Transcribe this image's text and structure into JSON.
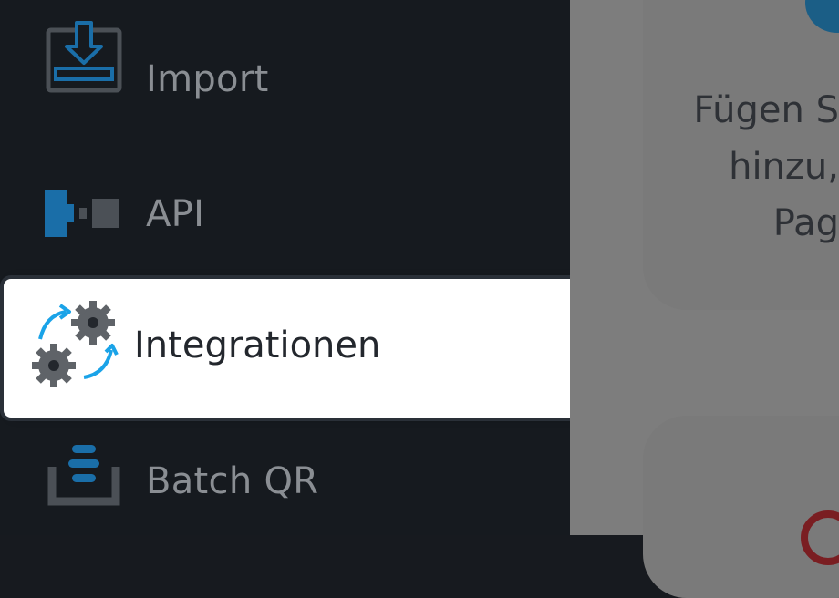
{
  "menu": {
    "items": [
      {
        "label": "Import",
        "icon": "import-icon"
      },
      {
        "label": "API",
        "icon": "api-icon"
      },
      {
        "label": "Integrationen",
        "icon": "integrations-gears-icon",
        "selected": true
      },
      {
        "label": "Batch QR",
        "icon": "batch-qr-icon"
      }
    ]
  },
  "background_card": {
    "lines": [
      "Fügen S",
      "hinzu,",
      "Pag"
    ]
  },
  "colors": {
    "sidebar_bg": "#161a1f",
    "selected_bg": "#ffffff",
    "accent_blue": "#1a6ea8",
    "icon_gray": "#4b5056",
    "arrow_cyan": "#1aa3e8"
  }
}
